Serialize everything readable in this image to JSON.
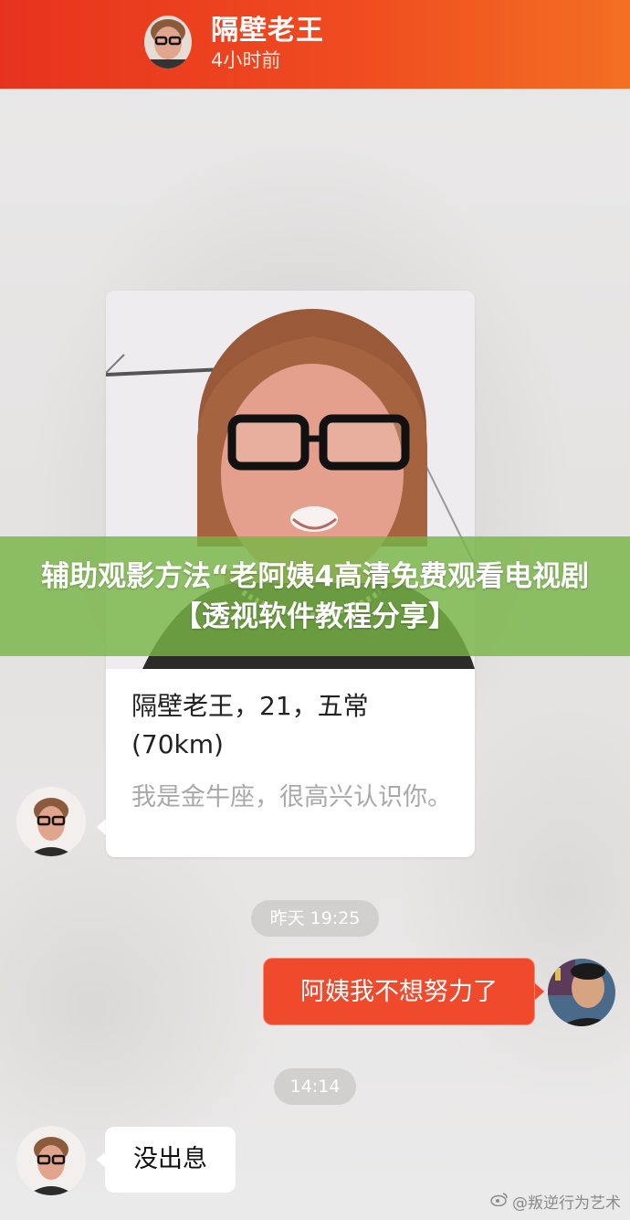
{
  "header": {
    "name": "隔壁老王",
    "time": "4小时前"
  },
  "card": {
    "title": "隔壁老王，21，五常(70km)",
    "bio": "我是金牛座，很高兴认识你。"
  },
  "messages": [
    {
      "type": "time",
      "text": "昨天 19:25"
    },
    {
      "type": "sent",
      "text": "阿姨我不想努力了"
    },
    {
      "type": "time",
      "text": "14:14"
    },
    {
      "type": "received",
      "text": "没出息"
    }
  ],
  "banner": {
    "text": "辅助观影方法“老阿姨4高清免费观看电视剧【透视软件教程分享】"
  },
  "watermark": {
    "text": "@叛逆行为艺术",
    "icon": "weibo-icon"
  },
  "colors": {
    "header_start": "#e7331e",
    "header_end": "#f36f22",
    "sent_bubble": "#f04a2d",
    "banner": "#78b446"
  }
}
